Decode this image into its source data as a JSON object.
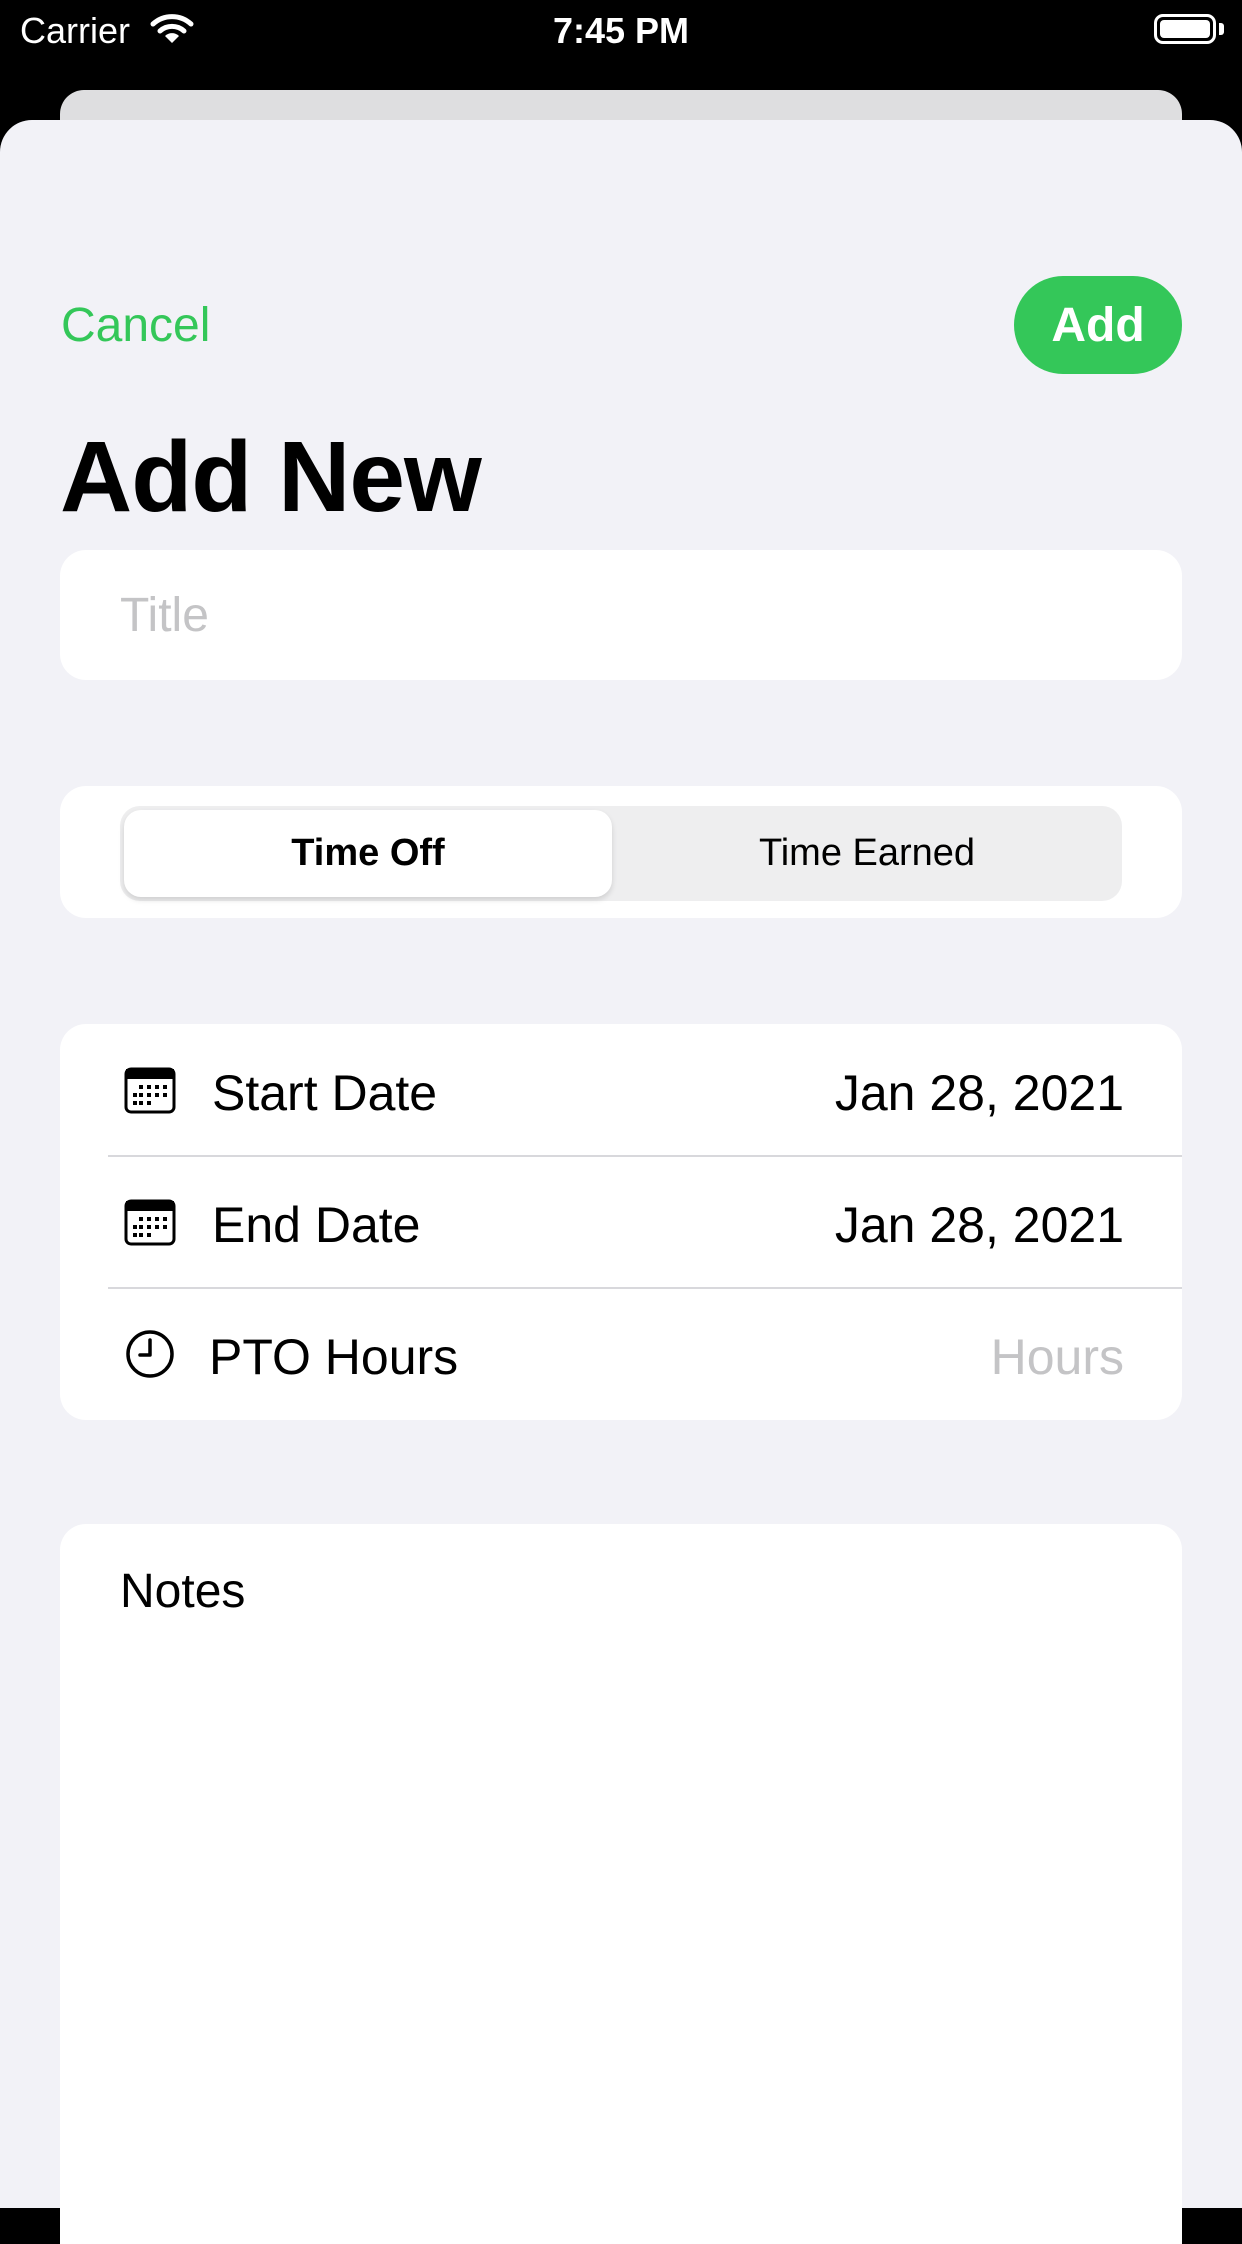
{
  "status_bar": {
    "carrier": "Carrier",
    "time": "7:45 PM"
  },
  "header": {
    "cancel_label": "Cancel",
    "add_label": "Add",
    "title": "Add New"
  },
  "title_field": {
    "placeholder": "Title",
    "value": ""
  },
  "segmented_control": {
    "options": [
      "Time Off",
      "Time Earned"
    ],
    "selected": "Time Off"
  },
  "details": {
    "start_date": {
      "label": "Start Date",
      "value": "Jan 28, 2021",
      "icon": "calendar-icon"
    },
    "end_date": {
      "label": "End Date",
      "value": "Jan 28, 2021",
      "icon": "calendar-icon"
    },
    "pto_hours": {
      "label": "PTO Hours",
      "placeholder": "Hours",
      "icon": "clock-icon"
    }
  },
  "notes": {
    "label": "Notes",
    "value": ""
  },
  "colors": {
    "accent": "#34c759",
    "background": "#f2f2f7",
    "card": "#ffffff",
    "placeholder": "#c4c4c6"
  }
}
